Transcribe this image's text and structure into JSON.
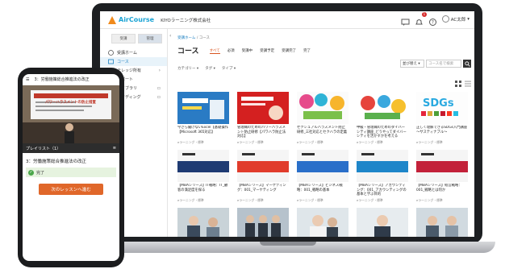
{
  "app": {
    "brand": "AirCourse",
    "org": "KIYOラーニング株式会社",
    "user": "AC太郎",
    "notif_badge": "1"
  },
  "sidebar": {
    "tabs": [
      "受講",
      "管理"
    ],
    "items": [
      {
        "label": "受講ホーム",
        "icon": "home-icon"
      },
      {
        "label": "コース",
        "icon": "course-icon"
      },
      {
        "label": "テレッジ所有",
        "icon": "folder-icon"
      },
      {
        "label": "レポート",
        "icon": "report-icon"
      },
      {
        "label": "ライブラリ",
        "icon": "library-icon"
      },
      {
        "label": "スタディング",
        "icon": "study-icon"
      }
    ]
  },
  "main": {
    "breadcrumb": {
      "home": "受講ホーム",
      "sep": "/",
      "current": "コース"
    },
    "title": "コース",
    "tabs": [
      "すべて",
      "必須",
      "受講中",
      "受講予定",
      "受講完了",
      "完了"
    ],
    "sort_select": "並び替え",
    "search_placeholder": "コース名で検索",
    "filters": [
      "カテゴリー",
      "タグ",
      "タイプ"
    ],
    "cards": [
      {
        "title": "今さら聞けないExcel【基礎操作【Microsoft 365対応】",
        "meta": "eラーニング・標準",
        "theme": "excel"
      },
      {
        "title": "管理職のためのパワーハラスメント防止研修【パワハラ防止法対応】",
        "meta": "eラーニング・標準",
        "theme": "red"
      },
      {
        "title": "セクシュアルハラスメント防止研修_三社対応とセクハラの定義",
        "meta": "eラーニング・標準",
        "theme": "pop"
      },
      {
        "title": "中級・管理職のためのダイバーシティ講座_どうやってダイバーシティを活かすかを考える",
        "meta": "eラーニング・標準",
        "theme": "pop2"
      },
      {
        "title": "正しく理解できるSDGs入門講座 〜サスティナブル〜",
        "meta": "eラーニング・標準",
        "theme": "sdgs"
      },
      {
        "title": "【MBAシリーズ】IT戦略：IT_顧客の満足度を探る",
        "meta": "eラーニング・標準",
        "theme": "mba-navy"
      },
      {
        "title": "【MBAシリーズ】マーケティング：001_マーケティング",
        "meta": "eラーニング・標準",
        "theme": "mba-red"
      },
      {
        "title": "【MBAシリーズ】ビジネス戦略：001_戦略の基本",
        "meta": "eラーニング・標準",
        "theme": "mba-blue"
      },
      {
        "title": "【MBAシリーズ】アカウンティング：001_アカウンティングの基本と学ぶ目的",
        "meta": "eラーニング・標準",
        "theme": "mba-teal"
      },
      {
        "title": "【MBAシリーズ】経営戦略：001_戦略とは何か",
        "meta": "eラーニング・標準",
        "theme": "mba-crimson"
      },
      {
        "title": "",
        "meta": "",
        "theme": "photo1"
      },
      {
        "title": "",
        "meta": "",
        "theme": "photo2"
      },
      {
        "title": "",
        "meta": "",
        "theme": "photo3"
      },
      {
        "title": "",
        "meta": "",
        "theme": "photo4"
      },
      {
        "title": "",
        "meta": "",
        "theme": "photo5"
      }
    ]
  },
  "phone": {
    "header": "3：労働施策総合推進法の改正",
    "video_caption": "パワーハラスメントの防止措置",
    "playlist": "プレイリスト（1）",
    "lesson": "3：労働施策総合推進法の改正",
    "status": "完了",
    "next_button": "次のレッスンへ進む"
  },
  "colors": {
    "brand": "#1aa3d4",
    "accent": "#d9541e",
    "next_button": "#e0672a",
    "done": "#4aa64a"
  }
}
